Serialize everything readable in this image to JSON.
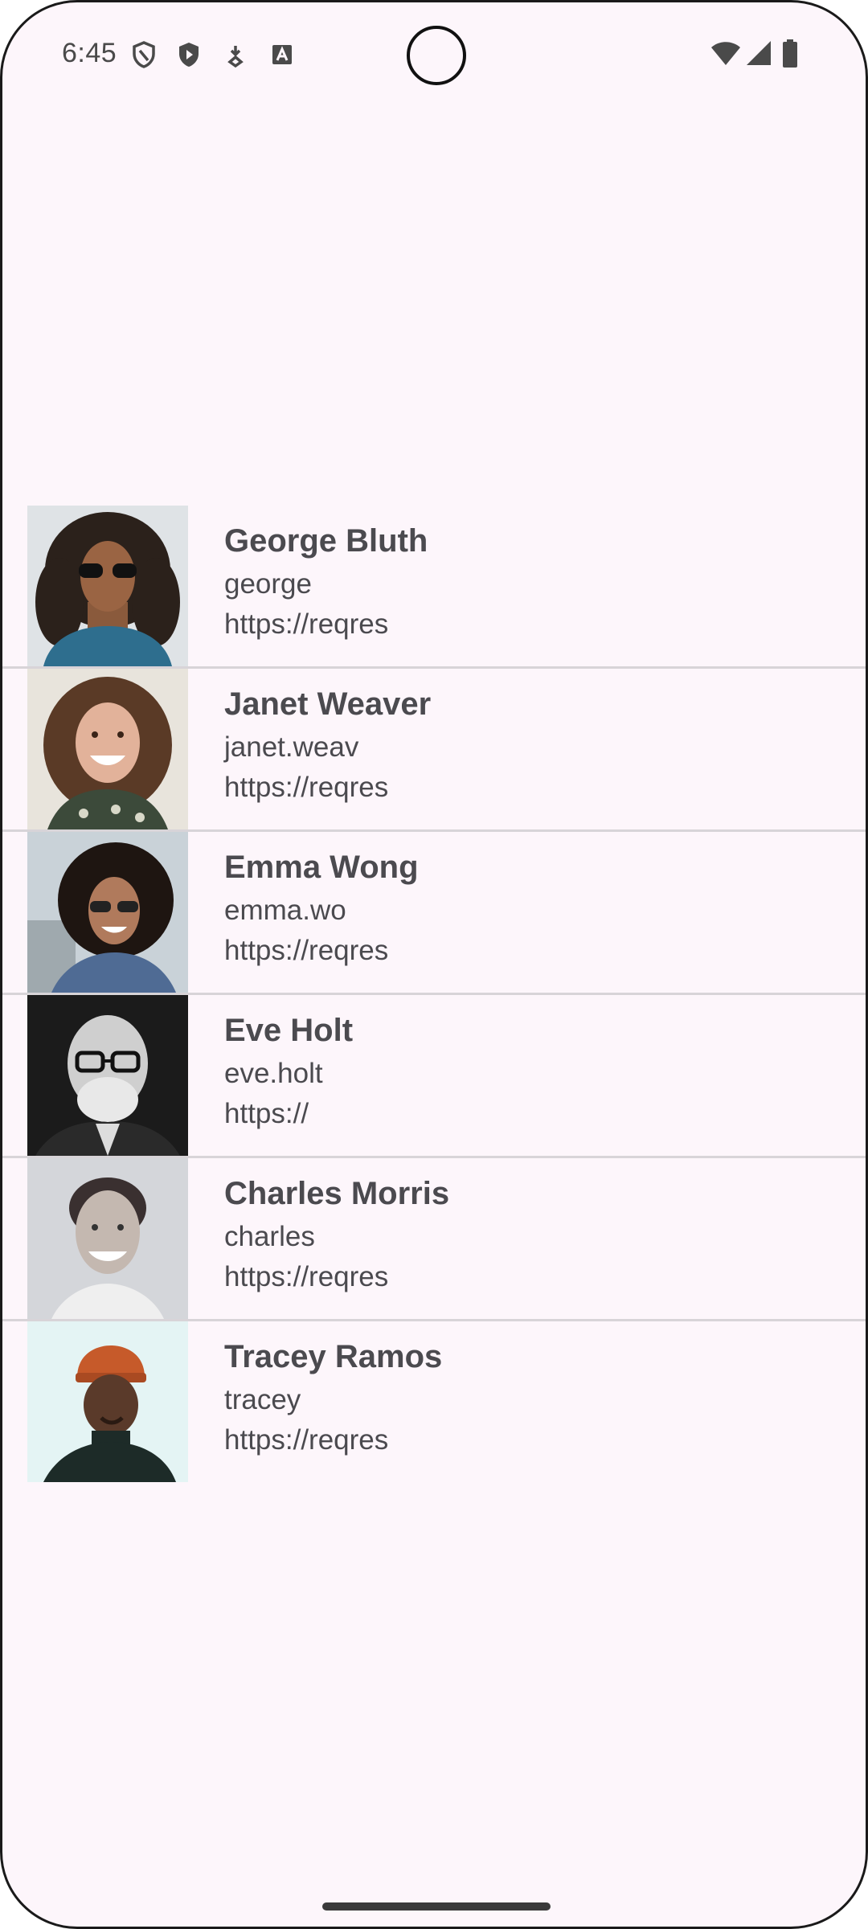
{
  "status_bar": {
    "time": "6:45",
    "left_icons": [
      "shield-outline-icon",
      "shield-filled-icon",
      "download-notification-icon",
      "font-a-icon"
    ],
    "right_icons": [
      "wifi-icon",
      "cellular-signal-icon",
      "battery-icon"
    ]
  },
  "users": [
    {
      "name": "George Bluth",
      "username": "george",
      "url": "https://reqres",
      "avatar": "avatar-george"
    },
    {
      "name": "Janet Weaver",
      "username": "janet.weav",
      "url": "https://reqres",
      "avatar": "avatar-janet"
    },
    {
      "name": "Emma Wong",
      "username": "emma.wo",
      "url": "https://reqres",
      "avatar": "avatar-emma"
    },
    {
      "name": "Eve Holt",
      "username": "eve.holt",
      "url": "https://",
      "avatar": "avatar-eve"
    },
    {
      "name": "Charles Morris",
      "username": "charles",
      "url": "https://reqres",
      "avatar": "avatar-charles"
    },
    {
      "name": "Tracey Ramos",
      "username": "tracey",
      "url": "https://reqres",
      "avatar": "avatar-tracey"
    }
  ],
  "colors": {
    "background": "#fdf6fb",
    "text": "#4b4a4f",
    "divider": "#d8d4d8"
  }
}
